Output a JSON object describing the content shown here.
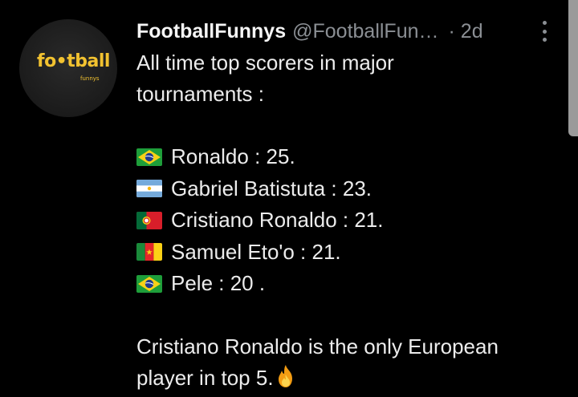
{
  "tweet": {
    "avatar": {
      "logo_text": "fo•tball",
      "logo_sub": "funnys"
    },
    "author_name": "FootballFunnys",
    "handle": "@FootballFun…",
    "time": "· 2d",
    "text_line_1": "All time top scorers in major",
    "text_line_2": "tournaments :",
    "scorers": [
      {
        "flag": "brazil-flag",
        "text": "Ronaldo : 25."
      },
      {
        "flag": "argentina-flag",
        "text": "Gabriel Batistuta : 23."
      },
      {
        "flag": "portugal-flag",
        "text": "Cristiano Ronaldo : 21."
      },
      {
        "flag": "cameroon-flag",
        "text": "Samuel Eto'o : 21."
      },
      {
        "flag": "brazil-flag",
        "text": "Pele : 20 ."
      }
    ],
    "outro_line_1": "Cristiano Ronaldo is the only European",
    "outro_line_2": "player in top 5.",
    "outro_emoji": "fire-icon"
  },
  "colors": {
    "background": "#000000",
    "text": "#ececec",
    "muted": "#8b8f94",
    "logo": "#f2c230"
  }
}
